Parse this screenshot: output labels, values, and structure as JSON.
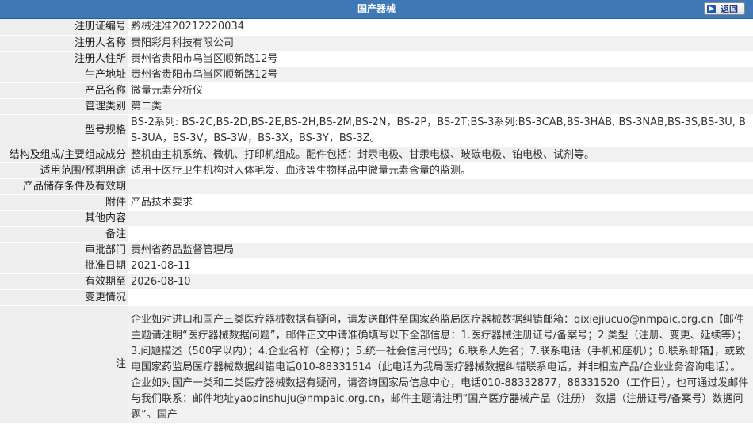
{
  "header": {
    "title": "国产器械",
    "back_label": "返回"
  },
  "rows": [
    {
      "label": "注册证编号",
      "value": "黔械注准20212220034"
    },
    {
      "label": "注册人名称",
      "value": "贵阳彩月科技有限公司"
    },
    {
      "label": "注册人住所",
      "value": "贵州省贵阳市乌当区顺新路12号"
    },
    {
      "label": "生产地址",
      "value": "贵州省贵阳市乌当区顺新路12号"
    },
    {
      "label": "产品名称",
      "value": "微量元素分析仪"
    },
    {
      "label": "管理类别",
      "value": "第二类"
    },
    {
      "label": "型号规格",
      "value": "BS-2系列: BS-2C,BS-2D,BS-2E,BS-2H,BS-2M,BS-2N，BS-2P，BS-2T;BS-3系列:BS-3CAB,BS-3HAB, BS-3NAB,BS-3S,BS-3U, BS-3UA，BS-3V，BS-3W，BS-3X，BS-3Y，BS-3Z。"
    },
    {
      "label": "结构及组成/主要组成成分",
      "value": "整机由主机系统、微机、打印机组成。配件包括：封汞电极、甘汞电极、玻碳电极、铂电极、试剂等。"
    },
    {
      "label": "适用范围/预期用途",
      "value": "适用于医疗卫生机构对人体毛发、血液等生物样品中微量元素含量的监测。"
    },
    {
      "label": "产品储存条件及有效期",
      "value": ""
    },
    {
      "label": "附件",
      "value": "产品技术要求"
    },
    {
      "label": "其他内容",
      "value": ""
    },
    {
      "label": "备注",
      "value": ""
    },
    {
      "label": "审批部门",
      "value": "贵州省药品监督管理局"
    },
    {
      "label": "批准日期",
      "value": "2021-08-11"
    },
    {
      "label": "有效期至",
      "value": "2026-08-10"
    },
    {
      "label": "变更情况",
      "value": ""
    }
  ],
  "note": {
    "label": "注",
    "text": "企业如对进口和国产三类医疗器械数据有疑问，请发送邮件至国家药监局医疗器械数据纠错邮箱：qixiejiucuo@nmpaic.org.cn【邮件主题请注明“医疗器械数据问题”，邮件正文中请准确填写以下全部信息：1.医疗器械注册证号/备案号；2.类型（注册、变更、延续等）；3.问题描述（500字以内）；4.企业名称（全称）；5.统一社会信用代码；6.联系人姓名；7.联系电话（手机和座机）；8.联系邮箱】，或致电国家药监局医疗器械数据纠错电话010-88331514（此电话为我局医疗器械数据纠错联系电话，并非相应产品/企业业务咨询电话）。企业如对国产一类和二类医疗器械数据有疑问，请咨询国家局信息中心，电话010-88332877，88331520（工作日），也可通过发邮件与我们联系：邮件地址yaopinshuju@nmpaic.org.cn，邮件主题请注明“国产医疗器械产品（注册）-数据（注册证号/备案号）数据问题”。国产"
  }
}
